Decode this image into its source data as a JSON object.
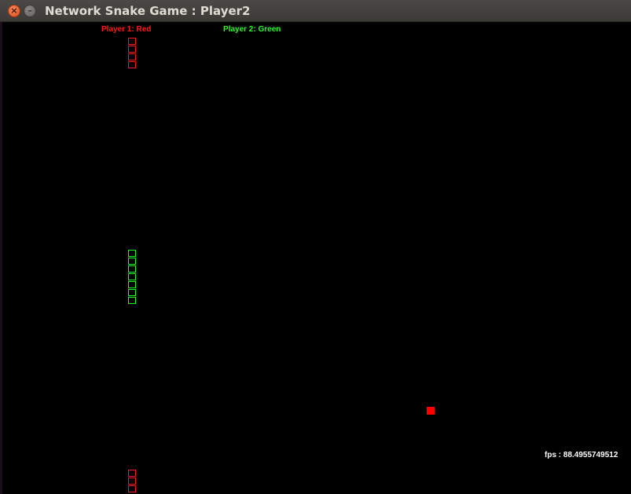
{
  "window": {
    "title": "Network Snake Game : Player2",
    "close_glyph": "×",
    "minimize_glyph": "–"
  },
  "players": {
    "p1_label": "Player 1: Red",
    "p2_label": "Player 2: Green",
    "p1_color": "#ff1a1a",
    "p2_color": "#22ff22"
  },
  "hud": {
    "fps_text": "fps : 88.4955749512"
  },
  "colors": {
    "background": "#000000",
    "food": "#ff0000",
    "snake_red": "#ff1a1a",
    "snake_green": "#22ff22"
  },
  "icons": [
    "close-icon",
    "minimize-icon"
  ]
}
